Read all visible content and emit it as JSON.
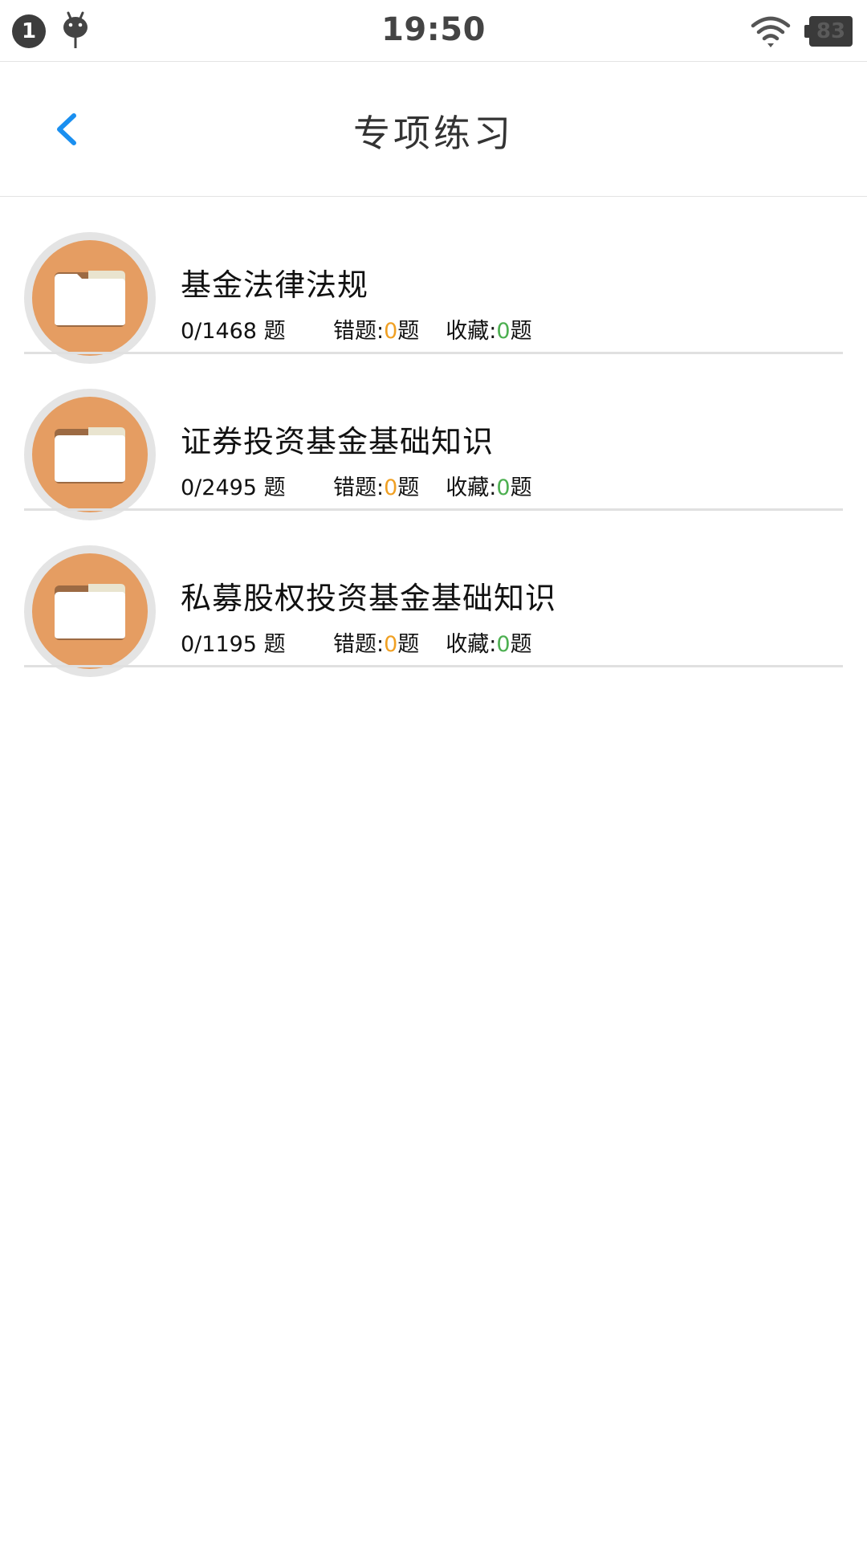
{
  "status_bar": {
    "notification_count": "1",
    "time": "19:50",
    "battery_level": "83",
    "icons": [
      "notification-badge",
      "android-debug-icon",
      "wifi-icon",
      "battery-icon"
    ]
  },
  "nav": {
    "title": "专项练习",
    "back_icon": "chevron-left-icon",
    "accent_color": "#1a8ff0"
  },
  "items": [
    {
      "title": "基金法律法规",
      "progress": "0/1468 题",
      "wrong_label": "错题:",
      "wrong_count": "0",
      "wrong_unit": "题",
      "fav_label": "收藏:",
      "fav_count": "0",
      "fav_unit": "题"
    },
    {
      "title": "证券投资基金基础知识",
      "progress": "0/2495 题",
      "wrong_label": "错题:",
      "wrong_count": "0",
      "wrong_unit": "题",
      "fav_label": "收藏:",
      "fav_count": "0",
      "fav_unit": "题"
    },
    {
      "title": "私募股权投资基金基础知识",
      "progress": "0/1195 题",
      "wrong_label": "错题:",
      "wrong_count": "0",
      "wrong_unit": "题",
      "fav_label": "收藏:",
      "fav_count": "0",
      "fav_unit": "题"
    }
  ],
  "colors": {
    "avatar": "#e59d62",
    "wrong_count": "#f0a023",
    "fav_count": "#4caf50"
  }
}
